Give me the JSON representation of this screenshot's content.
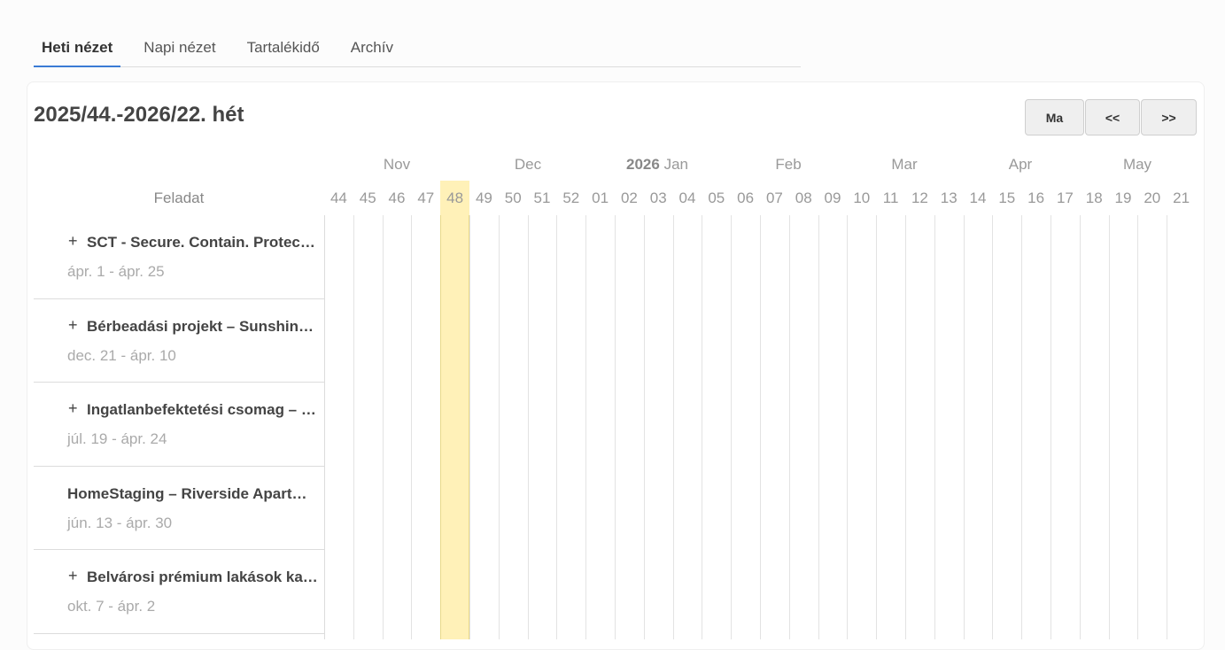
{
  "tabs": [
    {
      "label": "Heti nézet",
      "active": true
    },
    {
      "label": "Napi nézet",
      "active": false
    },
    {
      "label": "Tartalékidő",
      "active": false
    },
    {
      "label": "Archív",
      "active": false
    }
  ],
  "header": {
    "title": "2025/44.-2026/22. hét",
    "buttons": {
      "today": "Ma",
      "prev": "<<",
      "next": ">>"
    }
  },
  "timeline": {
    "task_column_label": "Feladat",
    "months": [
      {
        "label": "Nov",
        "year": ""
      },
      {
        "label": "Dec",
        "year": ""
      },
      {
        "label": "Jan",
        "year": "2026"
      },
      {
        "label": "Feb",
        "year": ""
      },
      {
        "label": "Mar",
        "year": ""
      },
      {
        "label": "Apr",
        "year": ""
      },
      {
        "label": "May",
        "year": ""
      }
    ],
    "weeks": [
      "44",
      "45",
      "46",
      "47",
      "48",
      "49",
      "50",
      "51",
      "52",
      "01",
      "02",
      "03",
      "04",
      "05",
      "06",
      "07",
      "08",
      "09",
      "10",
      "11",
      "12",
      "13",
      "14",
      "15",
      "16",
      "17",
      "18",
      "19",
      "20",
      "21"
    ],
    "current_week": "48"
  },
  "tasks": [
    {
      "name": "SCT - Secure. Contain. Protect. Bővítés",
      "dates": "ápr. 1 - ápr. 25",
      "expandable": true,
      "expand_icon": "+"
    },
    {
      "name": "Bérbeadási projekt – Sunshine Residence",
      "dates": "dec. 21 - ápr. 10",
      "expandable": true,
      "expand_icon": "+"
    },
    {
      "name": "Ingatlanbefektetési csomag – Central",
      "dates": "júl. 19 - ápr. 24",
      "expandable": true,
      "expand_icon": "+"
    },
    {
      "name": "HomeStaging – Riverside Apartments",
      "dates": "jún. 13 - ápr. 30",
      "expandable": false,
      "expand_icon": ""
    },
    {
      "name": "Belvárosi prémium lakások kampány",
      "dates": "okt. 7 - ápr. 2",
      "expandable": true,
      "expand_icon": "+"
    }
  ]
}
